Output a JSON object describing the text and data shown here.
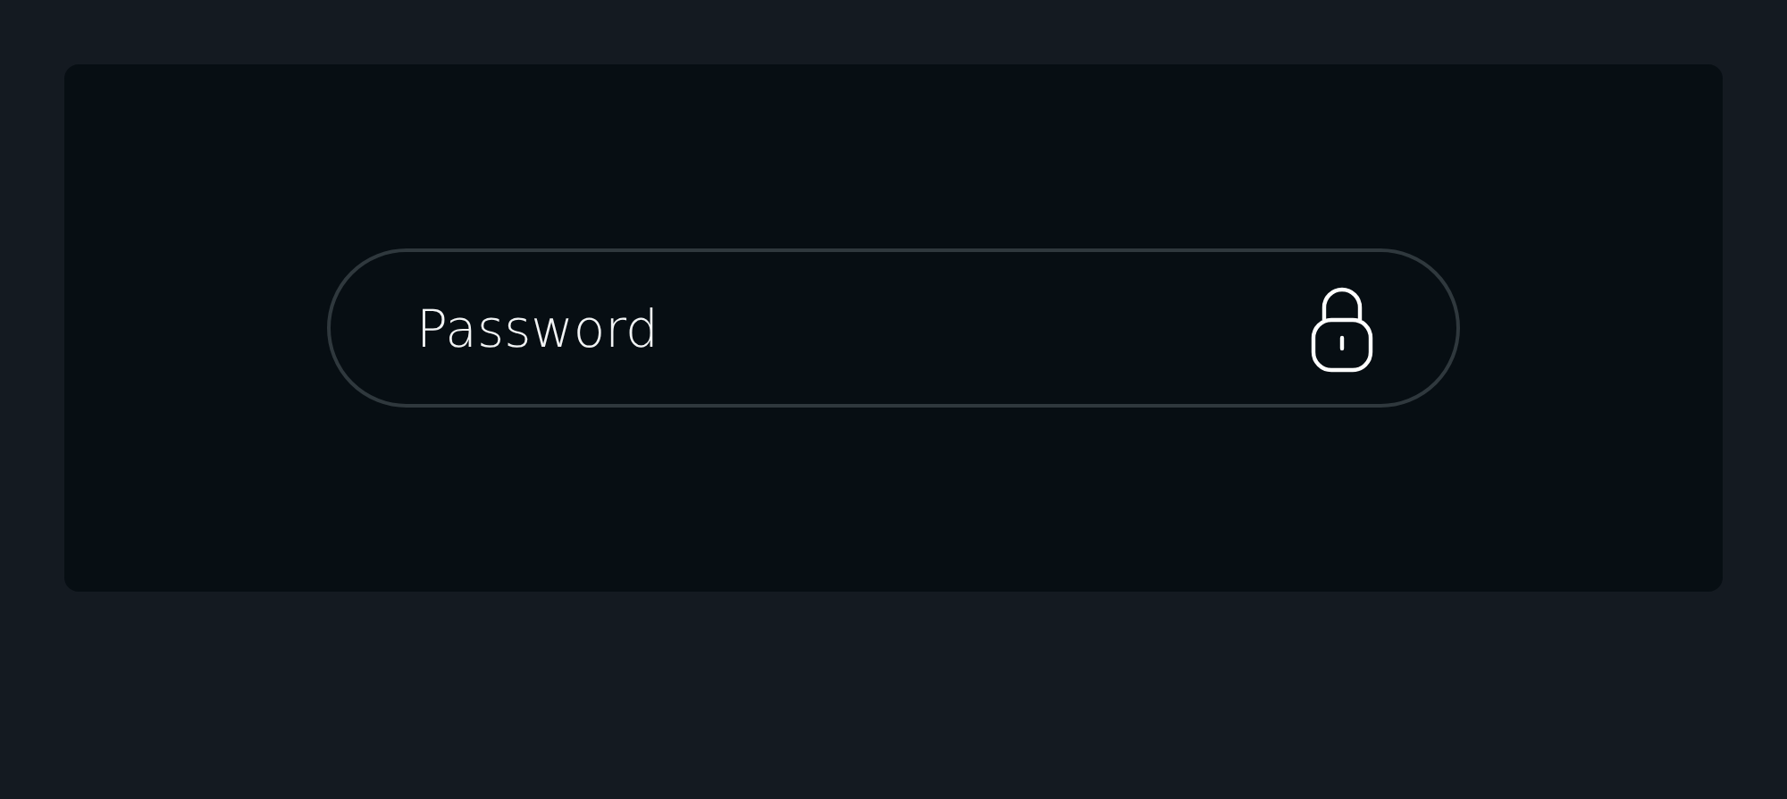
{
  "password_field": {
    "placeholder": "Password"
  }
}
